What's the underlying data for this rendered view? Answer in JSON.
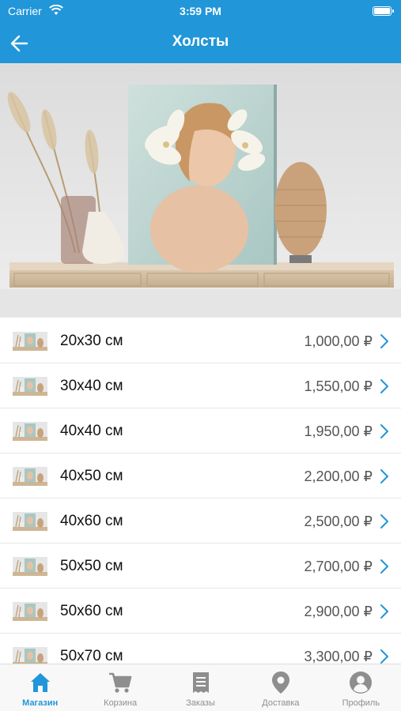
{
  "status_bar": {
    "carrier": "Carrier",
    "time": "3:59 PM"
  },
  "nav": {
    "title": "Холсты"
  },
  "products": [
    {
      "size": "20x30 см",
      "price": "1,000,00 ₽"
    },
    {
      "size": "30x40 см",
      "price": "1,550,00 ₽"
    },
    {
      "size": "40x40 см",
      "price": "1,950,00 ₽"
    },
    {
      "size": "40x50 см",
      "price": "2,200,00 ₽"
    },
    {
      "size": "40x60 см",
      "price": "2,500,00 ₽"
    },
    {
      "size": "50x50 см",
      "price": "2,700,00 ₽"
    },
    {
      "size": "50x60 см",
      "price": "2,900,00 ₽"
    },
    {
      "size": "50x70 см",
      "price": "3,300,00 ₽"
    }
  ],
  "tabs": [
    {
      "label": "Магазин",
      "icon": "home-icon",
      "active": true
    },
    {
      "label": "Корзина",
      "icon": "cart-icon",
      "active": false
    },
    {
      "label": "Заказы",
      "icon": "orders-icon",
      "active": false
    },
    {
      "label": "Доставка",
      "icon": "location-icon",
      "active": false
    },
    {
      "label": "Профиль",
      "icon": "profile-icon",
      "active": false
    }
  ],
  "colors": {
    "accent": "#2196d9",
    "tab_inactive": "#8e8e8e",
    "chevron": "#2196d9"
  }
}
